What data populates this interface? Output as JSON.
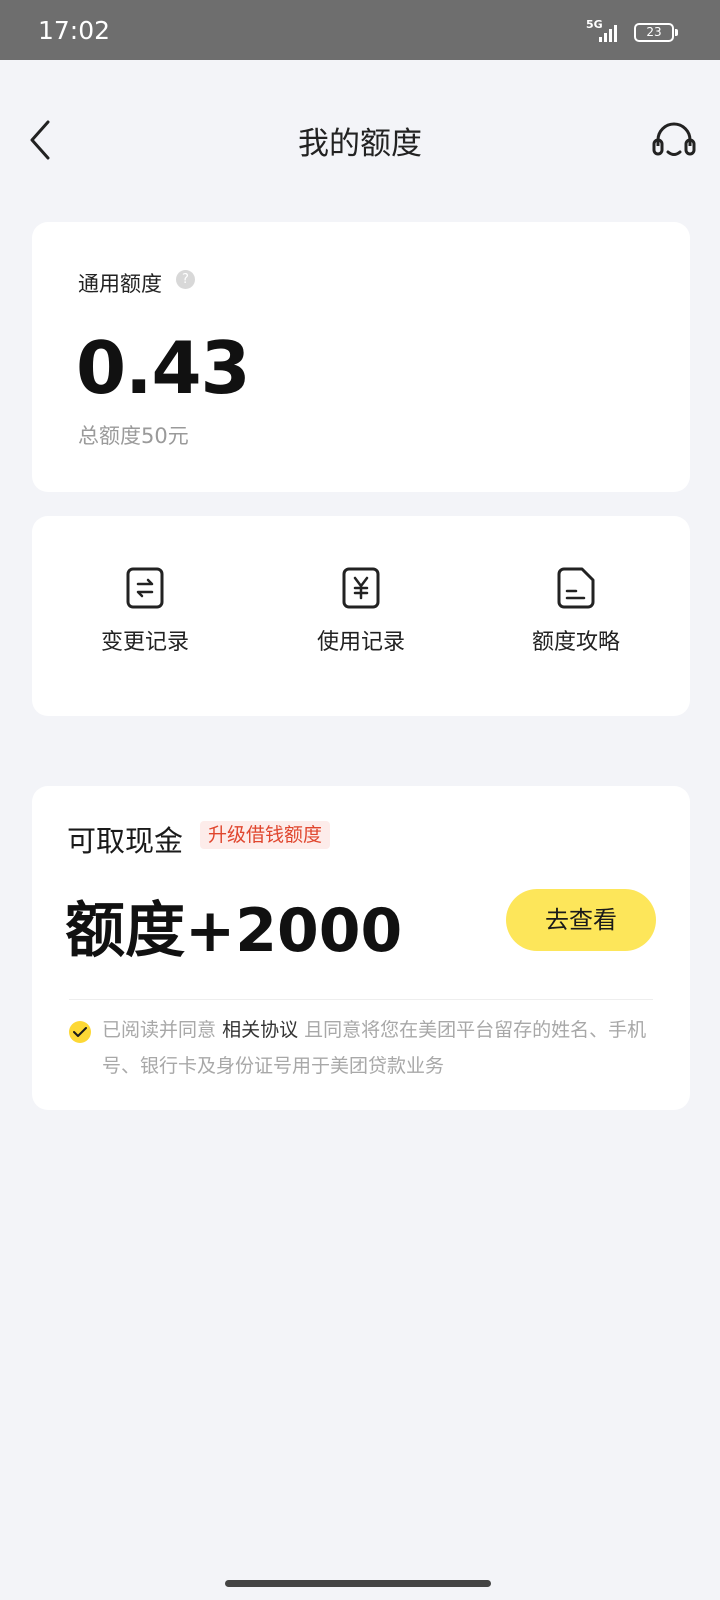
{
  "status_bar": {
    "time": "17:02",
    "network": "5G",
    "battery": "23"
  },
  "header": {
    "title": "我的额度",
    "back_icon": "chevron-left-icon",
    "service_icon": "headset-icon"
  },
  "quota_card": {
    "label": "通用额度",
    "help_icon": "?",
    "value": "0.43",
    "total": "总额度50元"
  },
  "actions": [
    {
      "label": "变更记录",
      "icon": "exchange-document-icon"
    },
    {
      "label": "使用记录",
      "icon": "yuan-document-icon"
    },
    {
      "label": "额度攻略",
      "icon": "text-document-icon"
    }
  ],
  "cash_card": {
    "title": "可取现金",
    "tag": "升级借钱额度",
    "amount": "额度+2000",
    "button": "去查看",
    "agreement": {
      "prefix": "已阅读并同意",
      "link": "相关协议",
      "suffix": "且同意将您在美团平台留存的姓名、手机号、银行卡及身份证号用于美团贷款业务"
    }
  },
  "colors": {
    "accent_yellow": "#fde65a",
    "tag_red": "#e0462e",
    "background": "#f3f4f8"
  }
}
